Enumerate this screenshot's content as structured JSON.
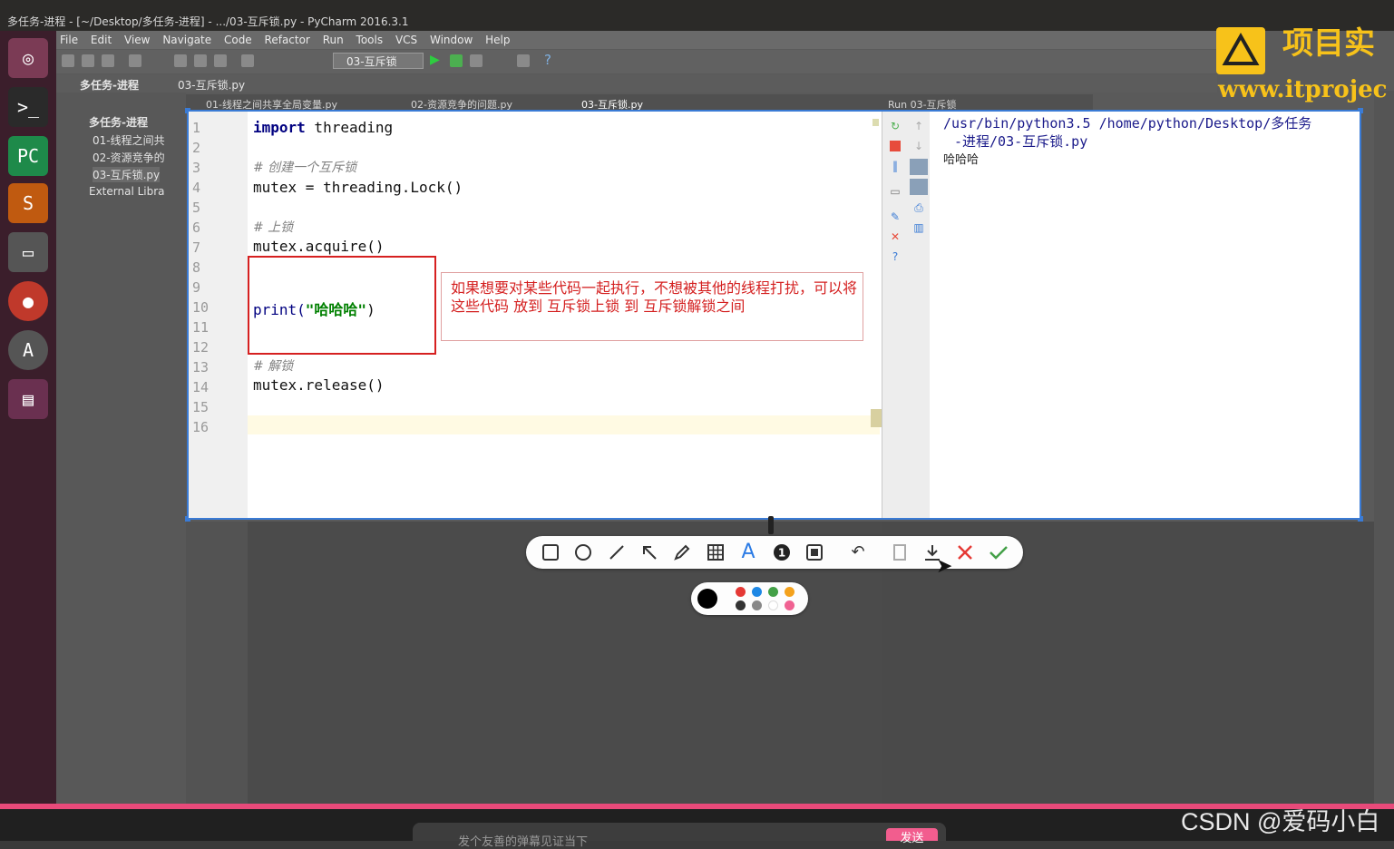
{
  "window": {
    "title": "多任务-进程 - [~/Desktop/多任务-进程] - .../03-互斥锁.py - PyCharm 2016.3.1"
  },
  "menu": [
    "File",
    "Edit",
    "View",
    "Navigate",
    "Code",
    "Refactor",
    "Run",
    "Tools",
    "VCS",
    "Window",
    "Help"
  ],
  "toolbar": {
    "run_config": "03-互斥锁"
  },
  "breadcrumb": {
    "project": "多任务-进程",
    "file": "03-互斥锁.py"
  },
  "project_tree": {
    "root": "多任务-进程",
    "files": [
      "01-线程之间共",
      "02-资源竞争的",
      "03-互斥锁.py"
    ],
    "external": "External Libra"
  },
  "tabs": [
    "01-线程之间共享全局变量.py",
    "02-资源竞争的问题.py",
    "03-互斥锁.py"
  ],
  "run_tab": "Run  03-互斥锁",
  "editor": {
    "line_numbers": [
      "1",
      "2",
      "3",
      "4",
      "5",
      "6",
      "7",
      "8",
      "9",
      "10",
      "11",
      "12",
      "13",
      "14",
      "15",
      "16"
    ],
    "l1_kw": "import",
    "l1_rest": " threading",
    "l3": "# 创建一个互斥锁",
    "l4": "mutex = threading.Lock()",
    "l6": "# 上锁",
    "l7": "mutex.acquire()",
    "l10_fn": "print(",
    "l10_str": "\"哈哈哈\"",
    "l10_end": ")",
    "l13": "# 解锁",
    "l14": "mutex.release()"
  },
  "console": {
    "line1": "/usr/bin/python3.5 /home/python/Desktop/多任务",
    "line2": "-进程/03-互斥锁.py",
    "line3": "哈哈哈"
  },
  "annotation": {
    "note": "如果想要对某些代码一起执行，不想被其他的线程打扰，可以将这些代码 放到 互斥锁上锁 到 互斥锁解锁之间"
  },
  "draw_tools": [
    "rectangle-tool",
    "ellipse-tool",
    "line-tool",
    "arrow-tool",
    "pen-tool",
    "mosaic-tool",
    "text-tool",
    "number-tool",
    "blur-tool",
    "undo",
    "save-to-pin",
    "download",
    "cancel",
    "confirm"
  ],
  "text_tool_glyph": "A",
  "number_tool_glyph": "1",
  "colors": {
    "accent": "#3a7bd5",
    "annotation_red": "#d62020",
    "palette": [
      "#000000",
      "#e53935",
      "#1e88e5",
      "#43a047",
      "#f4a21d",
      "#333333",
      "#888888",
      "#ffffff",
      "#f06292"
    ]
  },
  "logo": {
    "name": "项目实",
    "url": "www.itprojec"
  },
  "player": {
    "danmu_placeholder": "发个友善的弹幕见证当下",
    "send": "发送"
  },
  "watermark": "CSDN @爱码小白"
}
